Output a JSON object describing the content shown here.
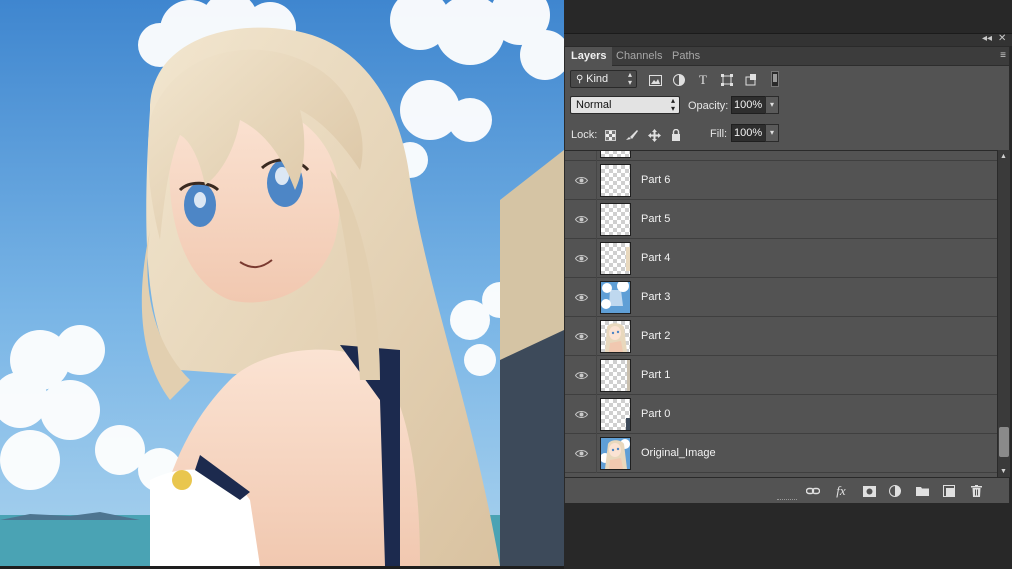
{
  "panel": {
    "collapse_glyph": "◂◂",
    "close_glyph": "✕",
    "menu_glyph": "≡",
    "tabs": [
      {
        "label": "Layers",
        "active": true
      },
      {
        "label": "Channels",
        "active": false
      },
      {
        "label": "Paths",
        "active": false
      }
    ],
    "filter": {
      "label": "Kind",
      "icons": [
        "image-filter-icon",
        "adjustment-filter-icon",
        "type-filter-icon",
        "shape-filter-icon",
        "smart-object-filter-icon",
        "filter-toggle-icon"
      ]
    },
    "blend_mode": "Normal",
    "opacity_label": "Opacity:",
    "opacity_value": "100%",
    "lock_label": "Lock:",
    "lock_icons": [
      "lock-transparency-icon",
      "lock-paint-icon",
      "lock-position-icon",
      "lock-all-icon"
    ],
    "fill_label": "Fill:",
    "fill_value": "100%",
    "layers": [
      {
        "name": "",
        "thumb": "transparent",
        "partial": true
      },
      {
        "name": "Part 6",
        "thumb": "transparent"
      },
      {
        "name": "Part 5",
        "thumb": "transparent"
      },
      {
        "name": "Part 4",
        "thumb": "transparent"
      },
      {
        "name": "Part 3",
        "thumb": "sky"
      },
      {
        "name": "Part 2",
        "thumb": "girl"
      },
      {
        "name": "Part 1",
        "thumb": "transparent"
      },
      {
        "name": "Part 0",
        "thumb": "transparent"
      },
      {
        "name": "Original_Image",
        "thumb": "full"
      }
    ],
    "footer_icons": [
      "link-layers-icon",
      "fx-icon",
      "add-mask-icon",
      "adjustment-layer-icon",
      "new-group-icon",
      "new-layer-icon",
      "delete-layer-icon"
    ],
    "fx_label": "fx"
  },
  "colors": {
    "panel_bg": "#535353",
    "sky": "#5f9fd6",
    "hair": "#e8d8bd",
    "eyes": "#4d86c6"
  }
}
